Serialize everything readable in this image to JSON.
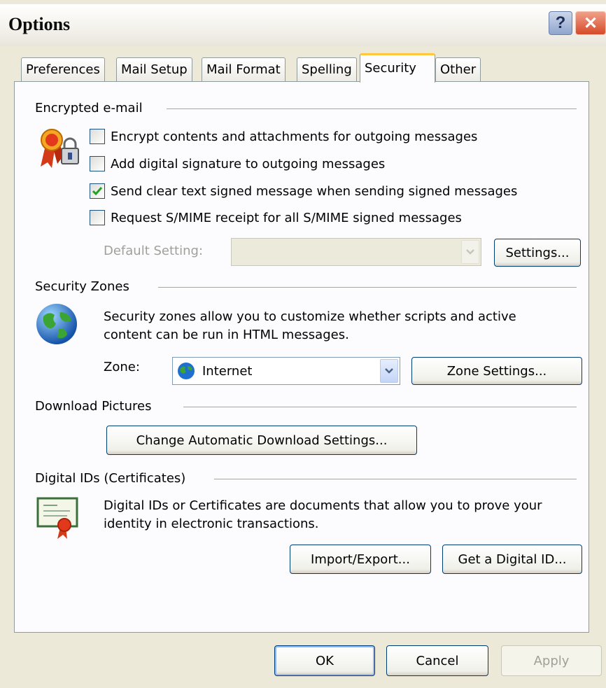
{
  "window": {
    "title": "Options",
    "help_glyph": "?",
    "close_glyph": "✕"
  },
  "tabs": [
    {
      "label": "Preferences",
      "active": false
    },
    {
      "label": "Mail Setup",
      "active": false
    },
    {
      "label": "Mail Format",
      "active": false
    },
    {
      "label": "Spelling",
      "active": false
    },
    {
      "label": "Security",
      "active": true
    },
    {
      "label": "Other",
      "active": false
    }
  ],
  "encrypted_email": {
    "title": "Encrypted e-mail",
    "icon": "certificate-lock-icon",
    "options": [
      {
        "label": "Encrypt contents and attachments for outgoing messages",
        "checked": false
      },
      {
        "label": "Add digital signature to outgoing messages",
        "checked": false
      },
      {
        "label": "Send clear text signed message when sending signed messages",
        "checked": true
      },
      {
        "label": "Request S/MIME receipt for all S/MIME signed messages",
        "checked": false
      }
    ],
    "default_setting_label": "Default Setting:",
    "default_setting_value": "",
    "settings_button": "Settings..."
  },
  "security_zones": {
    "title": "Security Zones",
    "icon": "globe-icon",
    "description": "Security zones allow you to customize whether scripts and active content can be run in HTML messages.",
    "zone_label": "Zone:",
    "zone_value": "Internet",
    "zone_settings_button": "Zone Settings..."
  },
  "download_pictures": {
    "title": "Download Pictures",
    "button": "Change Automatic Download Settings..."
  },
  "digital_ids": {
    "title": "Digital IDs (Certificates)",
    "icon": "certificate-icon",
    "description": "Digital IDs or Certificates are documents that allow you to prove your identity in electronic transactions.",
    "import_export_button": "Import/Export...",
    "get_id_button": "Get a Digital ID..."
  },
  "footer": {
    "ok": "OK",
    "cancel": "Cancel",
    "apply": "Apply"
  },
  "colors": {
    "dialog_bg": "#ece9d8",
    "panel_bg": "#fcfcfe",
    "tab_highlight": "#ffc83c",
    "check_green": "#21a121",
    "button_border": "#003c74"
  }
}
